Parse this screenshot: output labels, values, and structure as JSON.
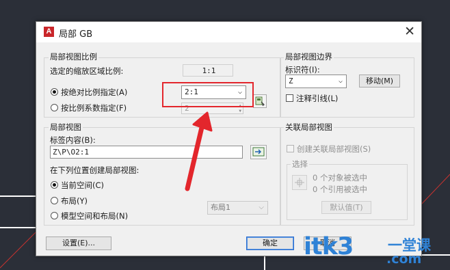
{
  "window": {
    "title": "局部 GB",
    "app_icon_letter": "A"
  },
  "scale_group": {
    "title": "局部视图比例",
    "selected_label": "选定的缩放区域比例:",
    "selected_value": "1:1",
    "radio_absolute": "按绝对比例指定(A)",
    "absolute_value": "2:1",
    "radio_factor": "按比例系数指定(F)",
    "factor_value": "2"
  },
  "boundary_group": {
    "title": "局部视图边界",
    "identifier_label": "标识符(I):",
    "identifier_value": "Z",
    "move_button": "移动(M)",
    "leader_checkbox": "注释引线(L)"
  },
  "view_group": {
    "title": "局部视图",
    "tag_label": "标签内容(B):",
    "tag_value": "Z\\P\\O2:1",
    "create_label": "在下列位置创建局部视图:",
    "radio_current": "当前空间(C)",
    "radio_layout": "布局(Y)",
    "radio_both": "模型空间和布局(N)",
    "layout_select": "布局1"
  },
  "related_group": {
    "title": "关联局部视图",
    "create_checkbox": "创建关联局部视图(S)",
    "select_title": "选择",
    "objects_selected": "0 个对象被选中",
    "refs_selected": "0 个引用被选中",
    "default_button": "默认值(T)"
  },
  "footer": {
    "settings_button": "设置(E)...",
    "ok_button": "确定",
    "cancel_button": "取消"
  },
  "watermark": {
    "text": "itk3",
    "cn": "一堂课",
    "com": ".com"
  },
  "colors": {
    "annotation_red": "#e3262c",
    "watermark_blue": "#2f82d6",
    "app_red": "#c9262a"
  }
}
